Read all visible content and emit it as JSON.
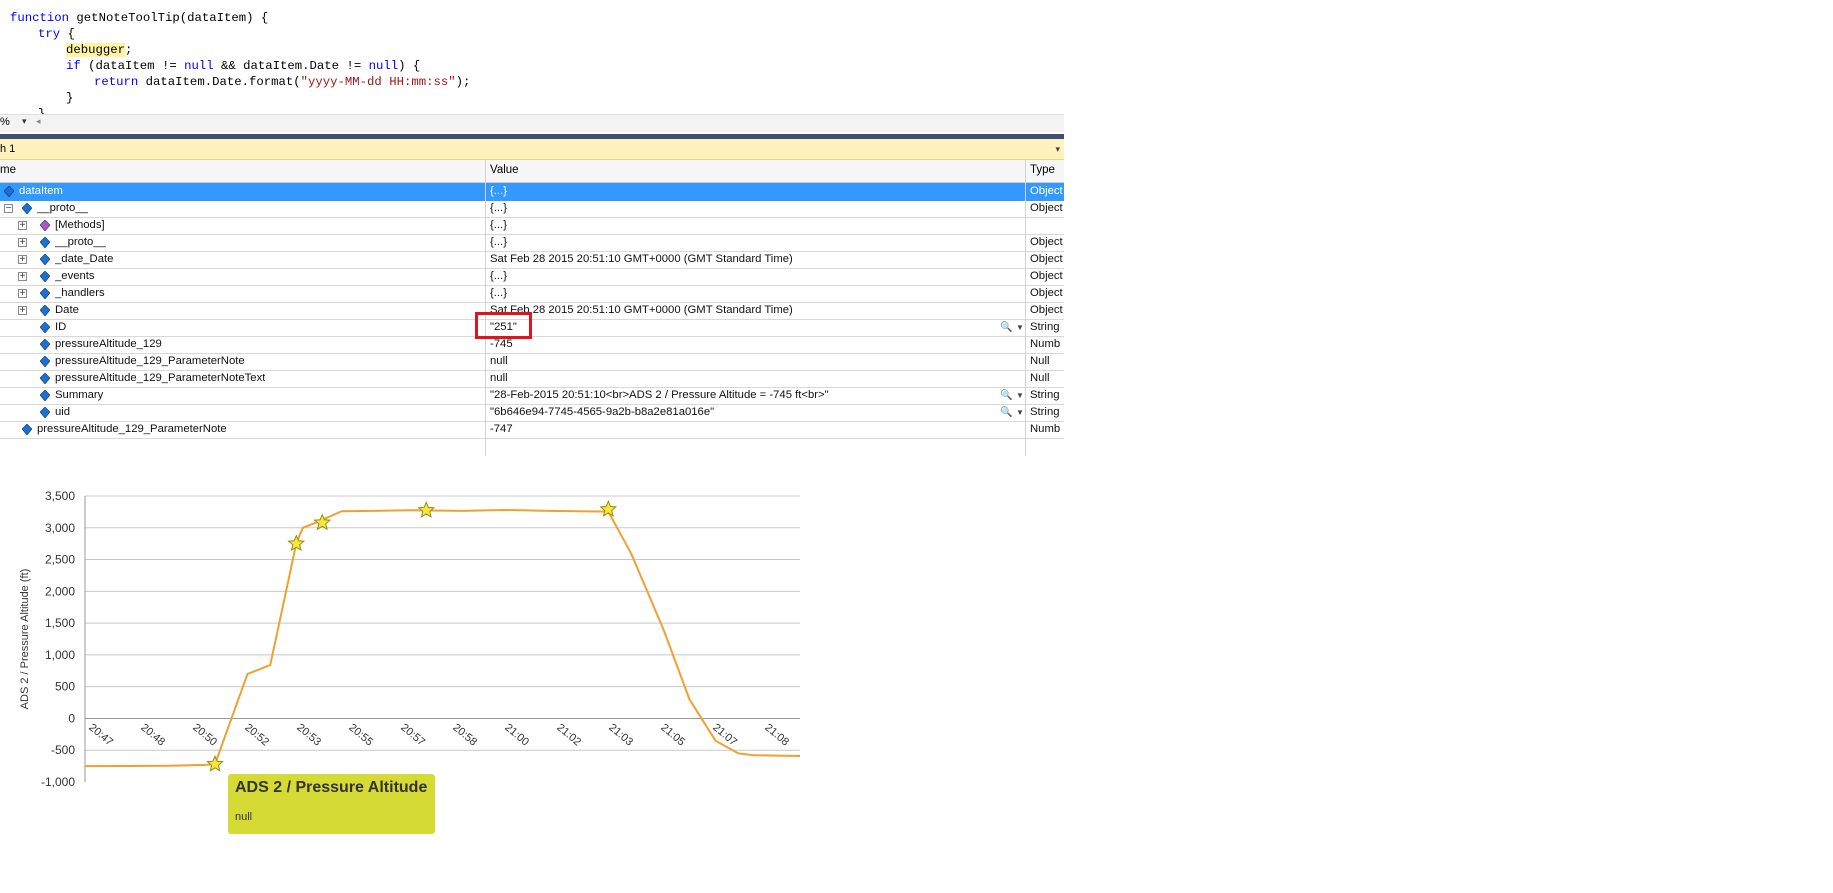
{
  "code": {
    "lines": [
      {
        "k1": "function",
        "t1": " getNoteToolTip(dataItem) {"
      },
      {
        "k1": "try",
        "t1": " {"
      },
      {
        "h": "debugger",
        "t1": ";"
      },
      {
        "k1": "if",
        "t1": " (dataItem != ",
        "k2": "null",
        "t2": " && dataItem.Date != ",
        "k3": "null",
        "t3": ") {"
      },
      {
        "k1": "return",
        "t1": " dataItem.Date.format(",
        "s": "\"yyyy-MM-dd HH:mm:ss\"",
        "t2": ");"
      },
      {
        "t1": "}"
      },
      {
        "t1": "}"
      }
    ]
  },
  "zoom": {
    "value": "%",
    "arrow": "▾",
    "scroll": "◂"
  },
  "watch": {
    "title": "h 1",
    "dropdown": "▾",
    "columns": {
      "name": "me",
      "value": "Value",
      "type": "Type"
    },
    "rows": [
      {
        "name": "dataItem",
        "value": "{...}",
        "type": "Object",
        "exp": "",
        "magnifier": false
      },
      {
        "name": "__proto__",
        "value": "{...}",
        "type": "Object",
        "exp": "−",
        "magnifier": false
      },
      {
        "name": "[Methods]",
        "value": "{...}",
        "type": "",
        "exp": "+",
        "magnifier": false
      },
      {
        "name": "__proto__",
        "value": "{...}",
        "type": "Object",
        "exp": "+",
        "magnifier": false
      },
      {
        "name": "_date_Date",
        "value": "Sat Feb 28 2015 20:51:10 GMT+0000 (GMT Standard Time)",
        "type": "Object",
        "exp": "+",
        "magnifier": false
      },
      {
        "name": "_events",
        "value": "{...}",
        "type": "Object",
        "exp": "+",
        "magnifier": false
      },
      {
        "name": "_handlers",
        "value": "{...}",
        "type": "Object",
        "exp": "+",
        "magnifier": false
      },
      {
        "name": "Date",
        "value": "Sat Feb 28 2015 20:51:10 GMT+0000 (GMT Standard Time)",
        "type": "Object",
        "exp": "+",
        "magnifier": false
      },
      {
        "name": "ID",
        "value": "\"251\"",
        "type": "String",
        "exp": "",
        "magnifier": true
      },
      {
        "name": "pressureAltitude_129",
        "value": "-745",
        "type": "Numb",
        "exp": "",
        "magnifier": false
      },
      {
        "name": "pressureAltitude_129_ParameterNote",
        "value": "null",
        "type": "Null",
        "exp": "",
        "magnifier": false
      },
      {
        "name": "pressureAltitude_129_ParameterNoteText",
        "value": "null",
        "type": "Null",
        "exp": "",
        "magnifier": false
      },
      {
        "name": "Summary",
        "value": "\"28-Feb-2015 20:51:10<br>ADS 2 /  Pressure Altitude = -745 ft<br>\"",
        "type": "String",
        "exp": "",
        "magnifier": true
      },
      {
        "name": "uid",
        "value": "\"6b646e94-7745-4565-9a2b-b8a2e81a016e\"",
        "type": "String",
        "exp": "",
        "magnifier": true
      },
      {
        "name": "pressureAltitude_129_ParameterNote",
        "value": "-747",
        "type": "Numb",
        "exp": "",
        "magnifier": false
      }
    ]
  },
  "tooltip": {
    "title": "ADS 2 / Pressure Altitude",
    "body": "null"
  },
  "chart_data": {
    "type": "line",
    "ylabel": "ADS 2 / Pressure Altitude (ft)",
    "xlabel": "",
    "ylim": [
      -1000,
      3500
    ],
    "y_ticks": [
      -1000,
      -500,
      0,
      500,
      1000,
      1500,
      2000,
      2500,
      3000,
      3500
    ],
    "y_tick_labels": [
      "-1,000",
      "-500",
      "0",
      "500",
      "1,000",
      "1,500",
      "2,000",
      "2,500",
      "3,000",
      "3,500"
    ],
    "x_tick_labels": [
      "20:47",
      "20:48",
      "20:50",
      "20:52",
      "20:53",
      "20:55",
      "20:57",
      "20:58",
      "21:00",
      "21:02",
      "21:03",
      "21:05",
      "21:07",
      "21:08"
    ],
    "x_ticks_min": [
      0,
      1.6,
      3.2,
      4.8,
      6.4,
      8,
      9.6,
      11.2,
      12.8,
      14.4,
      16,
      17.6,
      19.2,
      20.8
    ],
    "xlim_min": [
      -0.1,
      21.9
    ],
    "grid": true,
    "series": [
      {
        "color": "#f0a030",
        "x": [
          -0.1,
          2.5,
          3.6,
          3.9,
          4.9,
          5.6,
          6.4,
          6.6,
          7.0,
          7.8,
          9.9,
          11.5,
          12.8,
          14.2,
          16.0,
          16.7,
          17.7,
          18.5,
          19.3,
          20.0,
          20.5,
          21.9
        ],
        "y": [
          -750,
          -745,
          -730,
          -720,
          700,
          840,
          2750,
          3000,
          3080,
          3260,
          3275,
          3265,
          3280,
          3265,
          3255,
          2600,
          1400,
          300,
          -350,
          -550,
          -580,
          -590
        ]
      }
    ],
    "markers": [
      {
        "x": 3.9,
        "y": -720
      },
      {
        "x": 6.4,
        "y": 2750
      },
      {
        "x": 7.2,
        "y": 3080
      },
      {
        "x": 10.4,
        "y": 3275
      },
      {
        "x": 16.0,
        "y": 3290
      }
    ],
    "marker_color": "#f7e640"
  }
}
